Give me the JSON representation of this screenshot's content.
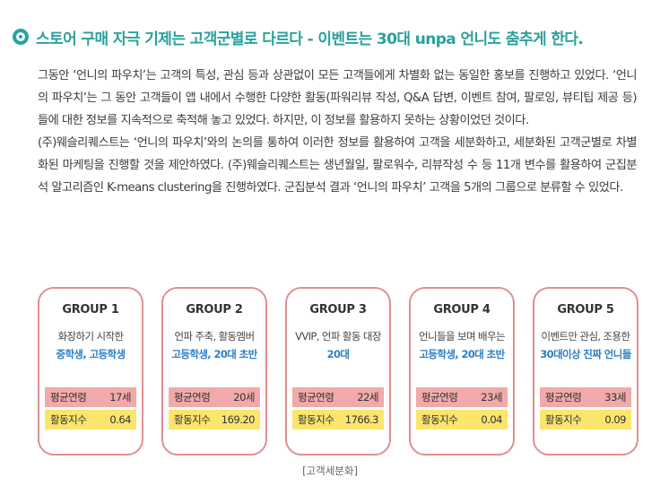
{
  "heading": "스토어 구매 자극 기제는 고객군별로 다르다 - 이벤트는 30대 unpa 언니도 춤추게 한다.",
  "paragraphs": [
    "그동안 ‘언니의 파우치’는 고객의 특성, 관심 등과 상관없이 모든 고객들에게 차별화 없는 동일한 홍보를 진행하고 있었다. ‘언니의 파우치’는 그 동안 고객들이 앱 내에서 수행한 다양한 활동(파워리뷰 작성, Q&A 답변, 이벤트 참여, 팔로잉, 뷰티팁 제공 등)들에 대한 정보를 지속적으로 축적해 놓고 있었다. 하지만, 이 정보를 활용하지 못하는 상황이었던 것이다.",
    "(주)웨슬리퀘스트는 ‘언니의 파우치’와의 논의를 통하여 이러한 정보를 활용하여 고객을 세분화하고, 세분화된 고객군별로 차별화된 마케팅을 진행할 것을 제안하였다. (주)웨슬리퀘스트는 생년월일, 팔로워수, 리뷰작성 수 등 11개 변수를 활용하여 군집분석 알고리즘인 K-means clustering을 진행하였다. 군집분석 결과 ‘언니의 파우치’ 고객을 5개의 그룹으로 분류할 수 있었다."
  ],
  "stat_labels": {
    "age": "평균연령",
    "activity": "활동지수"
  },
  "groups": [
    {
      "title": "GROUP 1",
      "desc": "화장하기 시작한",
      "target": "중학생, 고등학생",
      "age": "17세",
      "activity": "0.64"
    },
    {
      "title": "GROUP 2",
      "desc": "언파 주축, 활동멤버",
      "target": "고등학생, 20대 초반",
      "age": "20세",
      "activity": "169.20"
    },
    {
      "title": "GROUP 3",
      "desc": "VVIP, 언파 활동 대장",
      "target": "20대",
      "age": "22세",
      "activity": "1766.3"
    },
    {
      "title": "GROUP 4",
      "desc": "언니들을 보며 배우는",
      "target": "고등학생, 20대 초반",
      "age": "23세",
      "activity": "0.04"
    },
    {
      "title": "GROUP 5",
      "desc": "이벤트만 관심, 조용한",
      "target": "30대이상 진짜 언니들",
      "age": "33세",
      "activity": "0.09"
    }
  ],
  "caption": "[고객세분화]",
  "colors": {
    "accent": "#2aa19c",
    "card_border": "#e08f93",
    "age_bg": "#f1a9a9",
    "activity_bg": "#fbe56d",
    "target_text": "#2e7fc4"
  }
}
